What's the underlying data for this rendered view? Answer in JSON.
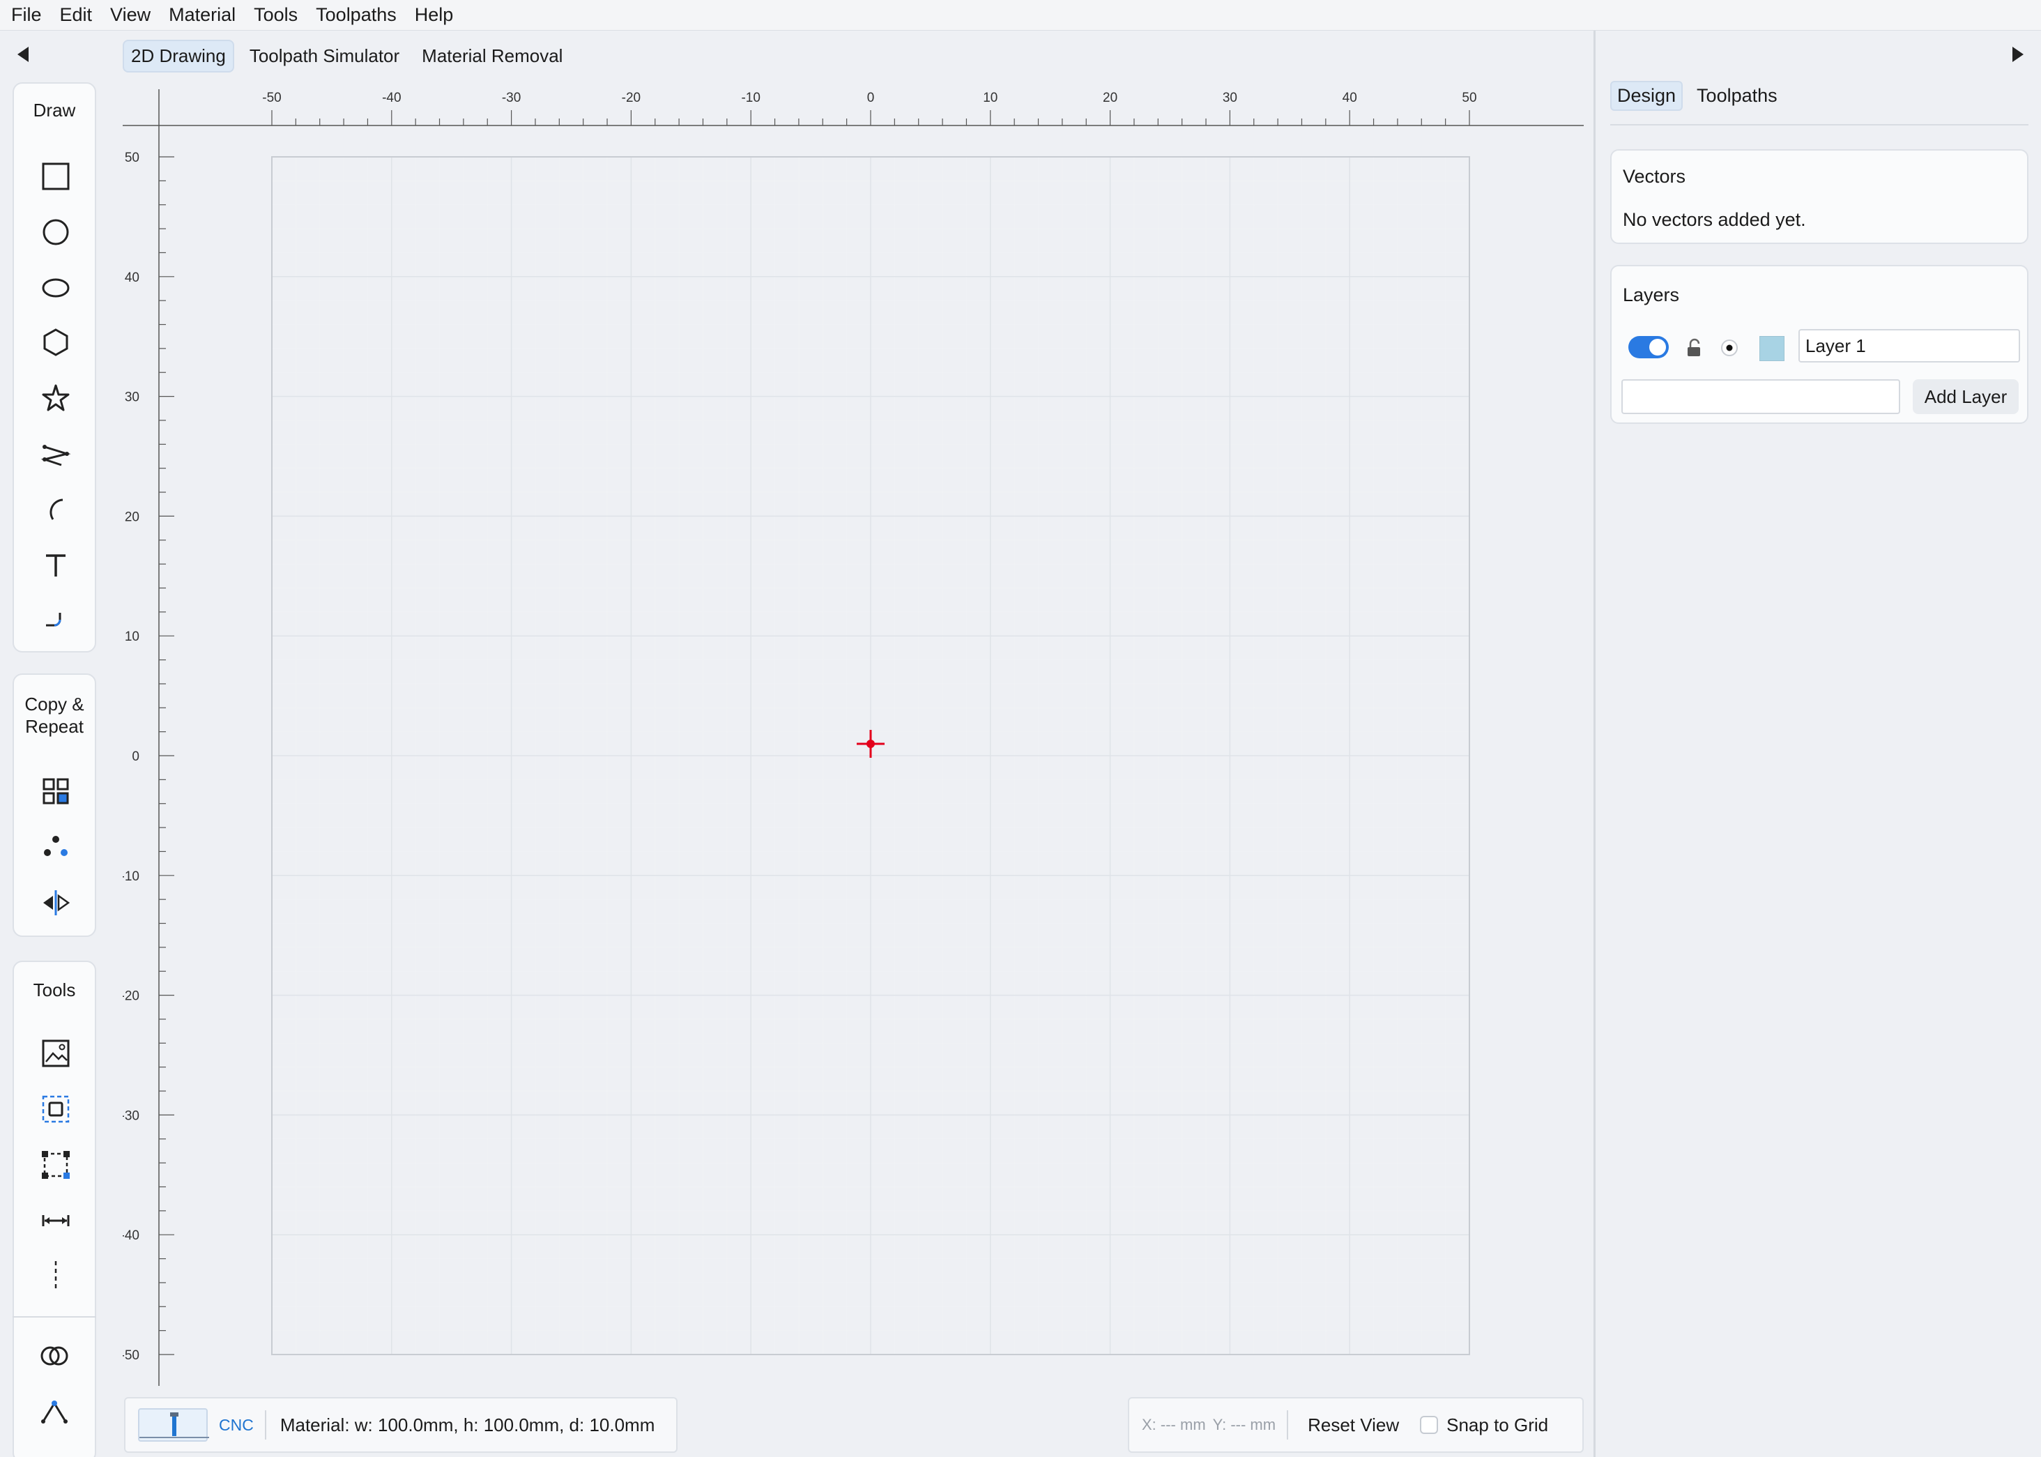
{
  "menu": [
    "File",
    "Edit",
    "View",
    "Material",
    "Tools",
    "Toolpaths",
    "Help"
  ],
  "view_tabs": [
    {
      "label": "2D Drawing",
      "active": true
    },
    {
      "label": "Toolpath Simulator",
      "active": false
    },
    {
      "label": "Material Removal",
      "active": false
    }
  ],
  "left_panel": {
    "draw_title": "Draw",
    "draw_tools": [
      "rectangle-icon",
      "circle-icon",
      "ellipse-icon",
      "hexagon-icon",
      "star-icon",
      "polyline-icon",
      "arc-icon",
      "text-icon",
      "fillet-icon"
    ],
    "copy_title_line1": "Copy &",
    "copy_title_line2": "Repeat",
    "copy_tools": [
      "grid-array-icon",
      "circular-array-icon",
      "mirror-icon"
    ],
    "tools_title": "Tools",
    "tools": [
      "image-trace-icon",
      "offset-icon",
      "transform-icon",
      "measure-icon",
      "guide-line-icon"
    ],
    "extra_tools": [
      "boolean-icon",
      "node-edit-icon"
    ]
  },
  "ruler": {
    "x_labels": [
      "-50",
      "-40",
      "-30",
      "-20",
      "-10",
      "0",
      "10",
      "20",
      "30",
      "40",
      "50"
    ],
    "y_labels": [
      "50",
      "40",
      "30",
      "20",
      "10",
      "0",
      "-10",
      "-20",
      "-30",
      "-40",
      "-50"
    ]
  },
  "status": {
    "machine_label": "CNC",
    "material_info": "Material: w: 100.0mm, h: 100.0mm, d: 10.0mm",
    "x_readout": "X: --- mm",
    "y_readout": "Y: --- mm",
    "reset_view": "Reset View",
    "snap_to_grid": "Snap to Grid",
    "snap_checked": false
  },
  "right_panel": {
    "tabs": [
      {
        "label": "Design",
        "active": true
      },
      {
        "label": "Toolpaths",
        "active": false
      }
    ],
    "vectors_title": "Vectors",
    "vectors_empty": "No vectors added yet.",
    "layers_title": "Layers",
    "layers": [
      {
        "name": "Layer 1",
        "visible": true,
        "color": "#a8d3e4"
      }
    ],
    "new_layer_placeholder": "",
    "add_layer": "Add Layer"
  },
  "colors": {
    "accent": "#2a7ae2",
    "origin_marker": "#e3001b"
  }
}
